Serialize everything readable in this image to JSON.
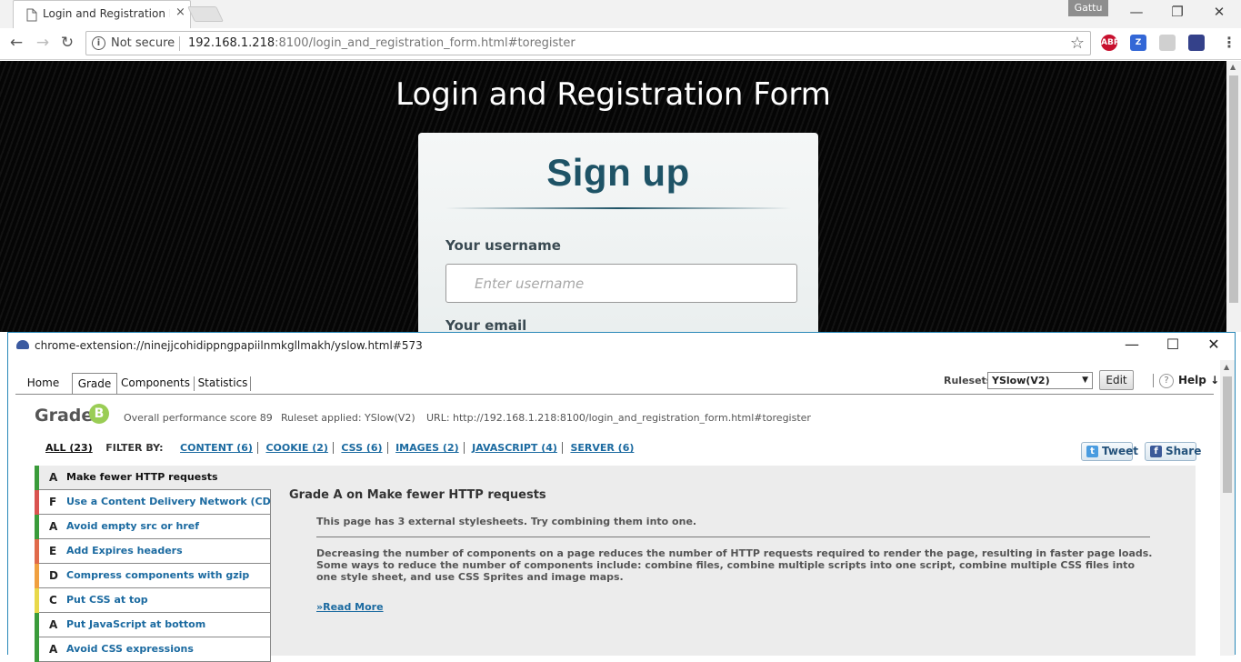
{
  "browser": {
    "tab_title": "Login and Registration Fo",
    "tab_close": "×",
    "profile_name": "Gattu",
    "security_label": "Not secure",
    "url_host": "192.168.1.218",
    "url_rest": ":8100/login_and_registration_form.html#toregister",
    "extensions": [
      {
        "name": "adblock-plus",
        "label": "ABP",
        "color": "#c8102e"
      },
      {
        "name": "zotero",
        "label": "Z",
        "color": "#3367d6"
      },
      {
        "name": "pdf",
        "label": "",
        "color": "#d0d0d0"
      },
      {
        "name": "yslow",
        "label": "",
        "color": "#34418a"
      }
    ]
  },
  "page": {
    "heading": "Login and Registration Form",
    "form_title": "Sign up",
    "username_label": "Your username",
    "username_placeholder": "Enter username",
    "email_label": "Your email"
  },
  "popup": {
    "title": "chrome-extension://ninejjcohidippngpapiilnmkgllmakh/yslow.html#573",
    "tabs": [
      {
        "label": "Home"
      },
      {
        "label": "Grade",
        "active": true
      },
      {
        "label": "Components"
      },
      {
        "label": "Statistics"
      }
    ],
    "rulesets_label": "Rulesets",
    "ruleset_value": "YSlow(V2)",
    "edit_label": "Edit",
    "help_icon": "?",
    "help_label": "Help ↓",
    "grade_word": "Grade",
    "grade_letter": "B",
    "score_text": "Overall performance score 89",
    "ruleset_applied": "Ruleset applied: YSlow(V2)",
    "url_text": "URL: http://192.168.1.218:8100/login_and_registration_form.html#toregister",
    "filter_all": "ALL (23)",
    "filter_by": "FILTER BY:",
    "filters": [
      "CONTENT (6)",
      "COOKIE (2)",
      "CSS (6)",
      "IMAGES (2)",
      "JAVASCRIPT (4)",
      "SERVER (6)"
    ],
    "tweet_label": "Tweet",
    "share_label": "Share",
    "rules": [
      {
        "grade": "A",
        "name": "Make fewer HTTP requests",
        "color": "#3a9b3a",
        "selected": true
      },
      {
        "grade": "F",
        "name": "Use a Content Delivery Network (CDN)",
        "color": "#d9534f"
      },
      {
        "grade": "A",
        "name": "Avoid empty src or href",
        "color": "#3a9b3a"
      },
      {
        "grade": "E",
        "name": "Add Expires headers",
        "color": "#e06a4a"
      },
      {
        "grade": "D",
        "name": "Compress components with gzip",
        "color": "#f0a040"
      },
      {
        "grade": "C",
        "name": "Put CSS at top",
        "color": "#e8d84a"
      },
      {
        "grade": "A",
        "name": "Put JavaScript at bottom",
        "color": "#3a9b3a"
      },
      {
        "grade": "A",
        "name": "Avoid CSS expressions",
        "color": "#3a9b3a"
      }
    ],
    "detail": {
      "title": "Grade A on Make fewer HTTP requests",
      "summary": "This page has 3 external stylesheets. Try combining them into one.",
      "description": "Decreasing the number of components on a page reduces the number of HTTP requests required to render the page, resulting in faster page loads. Some ways to reduce the number of components include: combine files, combine multiple scripts into one script, combine multiple CSS files into one style sheet, and use CSS Sprites and image maps.",
      "read_more": "»Read More"
    }
  }
}
